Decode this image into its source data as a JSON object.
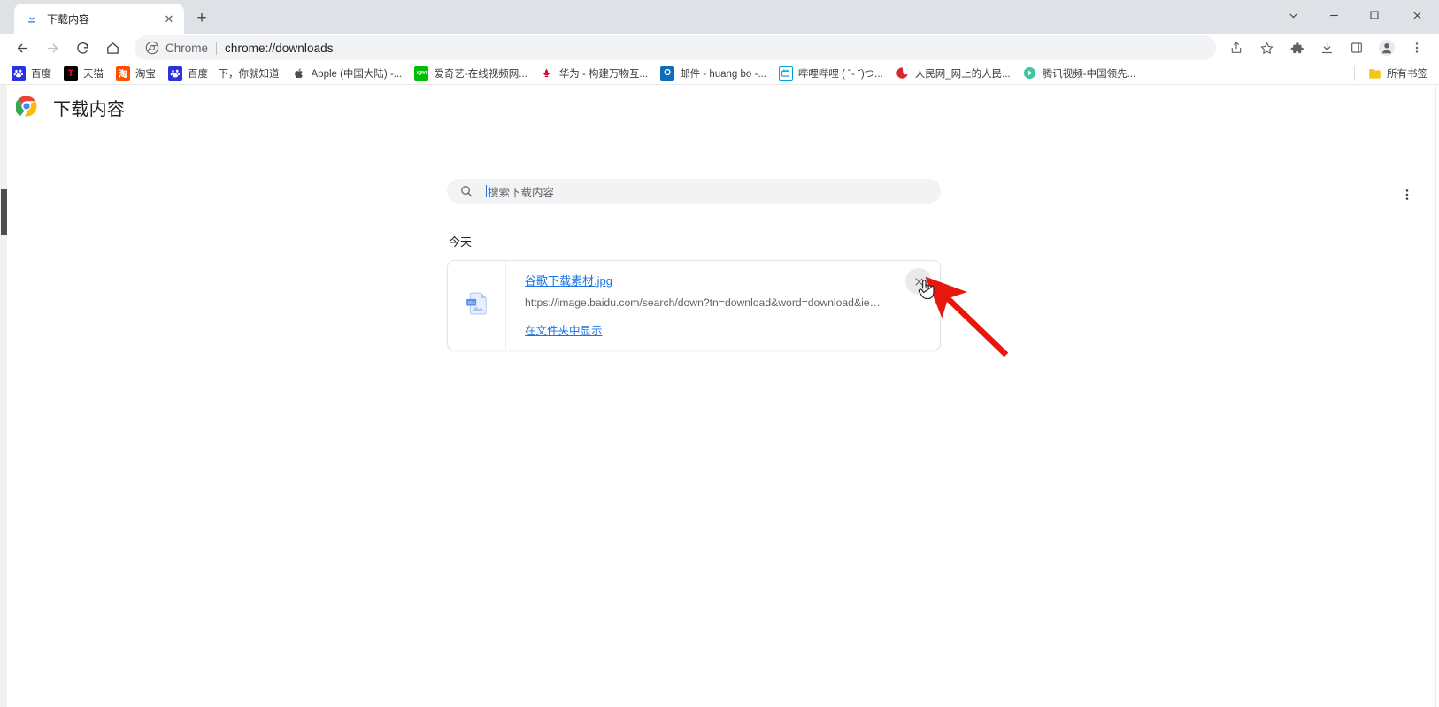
{
  "window": {
    "controls": [
      {
        "name": "tab-search",
        "icon": "chevron-down-icon",
        "label": "∨"
      },
      {
        "name": "minimize",
        "icon": "minimize-icon",
        "label": "─"
      },
      {
        "name": "maximize",
        "icon": "maximize-icon",
        "label": "□"
      },
      {
        "name": "close",
        "icon": "close-icon",
        "label": "✕"
      }
    ]
  },
  "tabstrip": {
    "tab": {
      "title": "下载内容",
      "favicon": "download-icon",
      "close_label": "✕"
    },
    "new_tab_label": "+",
    "new_tab_name": "new-tab-button"
  },
  "toolbar": {
    "back_label": "←",
    "forward_label": "→",
    "reload_label": "↻",
    "home_label": "⌂",
    "omnibox": {
      "chip_label": "Chrome",
      "url": "chrome://downloads"
    },
    "right_icons": [
      {
        "name": "share-icon",
        "glyph": "share"
      },
      {
        "name": "bookmark-star-icon",
        "glyph": "star"
      },
      {
        "name": "extensions-puzzle-icon",
        "glyph": "puzzle"
      },
      {
        "name": "downloads-icon",
        "glyph": "download"
      },
      {
        "name": "side-panel-icon",
        "glyph": "panel"
      },
      {
        "name": "profile-avatar-icon",
        "glyph": "avatar"
      },
      {
        "name": "browser-menu-icon",
        "glyph": "kebab"
      }
    ]
  },
  "bookmarks": {
    "items": [
      {
        "label": "百度",
        "icon": "baidu-icon",
        "color": "#2932e1",
        "glyph": "熊"
      },
      {
        "label": "天猫",
        "icon": "tmall-icon",
        "color": "#000000",
        "glyph": "T"
      },
      {
        "label": "淘宝",
        "icon": "taobao-icon",
        "color": "#ff5000",
        "glyph": "淘"
      },
      {
        "label": "百度一下，你就知道",
        "icon": "baidu-icon",
        "color": "#2932e1",
        "glyph": "熊"
      },
      {
        "label": "Apple (中国大陆) -...",
        "icon": "apple-icon",
        "color": "#555555",
        "glyph": ""
      },
      {
        "label": "爱奇艺-在线视频网...",
        "icon": "iqiyi-icon",
        "color": "#00be06",
        "glyph": "iQIYI"
      },
      {
        "label": "华为 - 构建万物互...",
        "icon": "huawei-icon",
        "color": "#cf0a2c",
        "glyph": "华"
      },
      {
        "label": "邮件 - huang bo -...",
        "icon": "outlook-icon",
        "color": "#0f6cbd",
        "glyph": "O"
      },
      {
        "label": "哔哩哔哩 ( ˘- ˘)つ...",
        "icon": "bilibili-icon",
        "color": "#00a1d6",
        "glyph": "тв"
      },
      {
        "label": "人民网_网上的人民...",
        "icon": "people-icon",
        "color": "#d8282b",
        "glyph": "人"
      },
      {
        "label": "腾讯视频-中国领先...",
        "icon": "tencent-video-icon",
        "color": "#33cc66",
        "glyph": "▶"
      }
    ],
    "all_bookmarks": {
      "label": "所有书签",
      "icon": "folder-icon"
    }
  },
  "downloads_page": {
    "logo": "chrome-logo-icon",
    "title": "下载内容",
    "search": {
      "placeholder": "搜索下载内容",
      "icon": "search-icon",
      "value": ""
    },
    "menu_icon": "kebab-menu-icon",
    "group_label": "今天",
    "item": {
      "file_icon": "jpg-image-file-icon",
      "filename": "谷歌下载素材.jpg",
      "url": "https://image.baidu.com/search/down?tn=download&word=download&ie=utf8&fr=...",
      "show_in_folder_label": "在文件夹中显示",
      "remove_label": "✕",
      "remove_name": "remove-download-button"
    }
  },
  "annotation": {
    "arrow_color": "#e8160c",
    "cursor": "pointer-hand-cursor"
  }
}
